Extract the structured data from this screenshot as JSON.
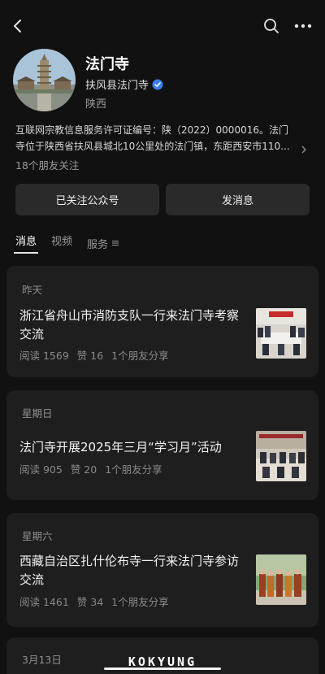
{
  "account": {
    "name": "法门寺",
    "verified_by": "扶风县法门寺",
    "region": "陕西",
    "description_lines": [
      "互联网宗教信息服务许可证编号：陕（2022）0000016。法门",
      "寺位于陕西省扶风县城北10公里处的法门镇，东距西安市110..."
    ],
    "friends_following": "18个朋友关注"
  },
  "actions": {
    "followed_label": "已关注公众号",
    "message_label": "发消息"
  },
  "tabs": [
    {
      "label": "消息",
      "active": true
    },
    {
      "label": "视频",
      "active": false
    },
    {
      "label": "服务",
      "active": false
    }
  ],
  "articles": [
    {
      "date": "昨天",
      "title": "浙江省舟山市消防支队一行来法门寺考察交流",
      "reads": "阅读 1569",
      "likes": "赞 16",
      "shares": "1个朋友分享"
    },
    {
      "date": "星期日",
      "title": "法门寺开展2025年三月“学习月”活动",
      "reads": "阅读 905",
      "likes": "赞 20",
      "shares": "1个朋友分享"
    },
    {
      "date": "星期六",
      "title": "西藏自治区扎什伦布寺一行来法门寺参访交流",
      "reads": "阅读 1461",
      "likes": "赞 34",
      "shares": "1个朋友分享"
    },
    {
      "date": "3月13日"
    }
  ],
  "watermark": "KOKYUNG",
  "icons": {
    "back": "chevron-left-icon",
    "search": "search-icon",
    "more": "more-icon",
    "verified": "verified-badge-icon",
    "services": "menu-icon"
  },
  "colors": {
    "background": "#111111",
    "card": "#1e1e1e",
    "button": "#2a2a2a",
    "verified": "#3d7bf0"
  }
}
